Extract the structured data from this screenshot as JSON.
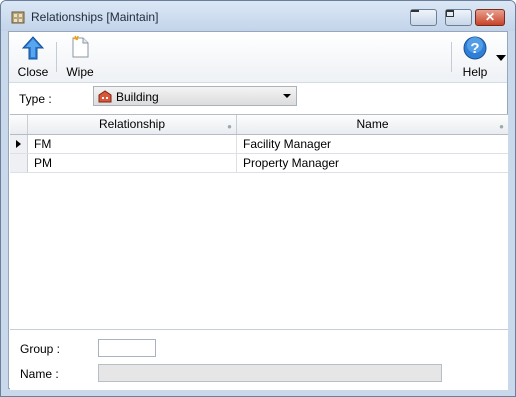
{
  "window": {
    "title": "Relationships [Maintain]",
    "minimize_icon": "minimize-icon",
    "maximize_icon": "maximize-icon",
    "close_glyph": "✕"
  },
  "toolbar": {
    "close_label": "Close",
    "wipe_label": "Wipe",
    "help_label": "Help"
  },
  "type_filter": {
    "label": "Type :",
    "selected": "Building"
  },
  "grid": {
    "columns": [
      "Relationship",
      "Name"
    ],
    "rows": [
      {
        "relationship": "FM",
        "name": "Facility Manager",
        "current": true
      },
      {
        "relationship": "PM",
        "name": "Property Manager",
        "current": false
      }
    ]
  },
  "form": {
    "group_label": "Group :",
    "group_value": "",
    "name_label": "Name :",
    "name_value": ""
  },
  "colors": {
    "accent": "#1f6fd0",
    "close_button": "#c8432a"
  }
}
